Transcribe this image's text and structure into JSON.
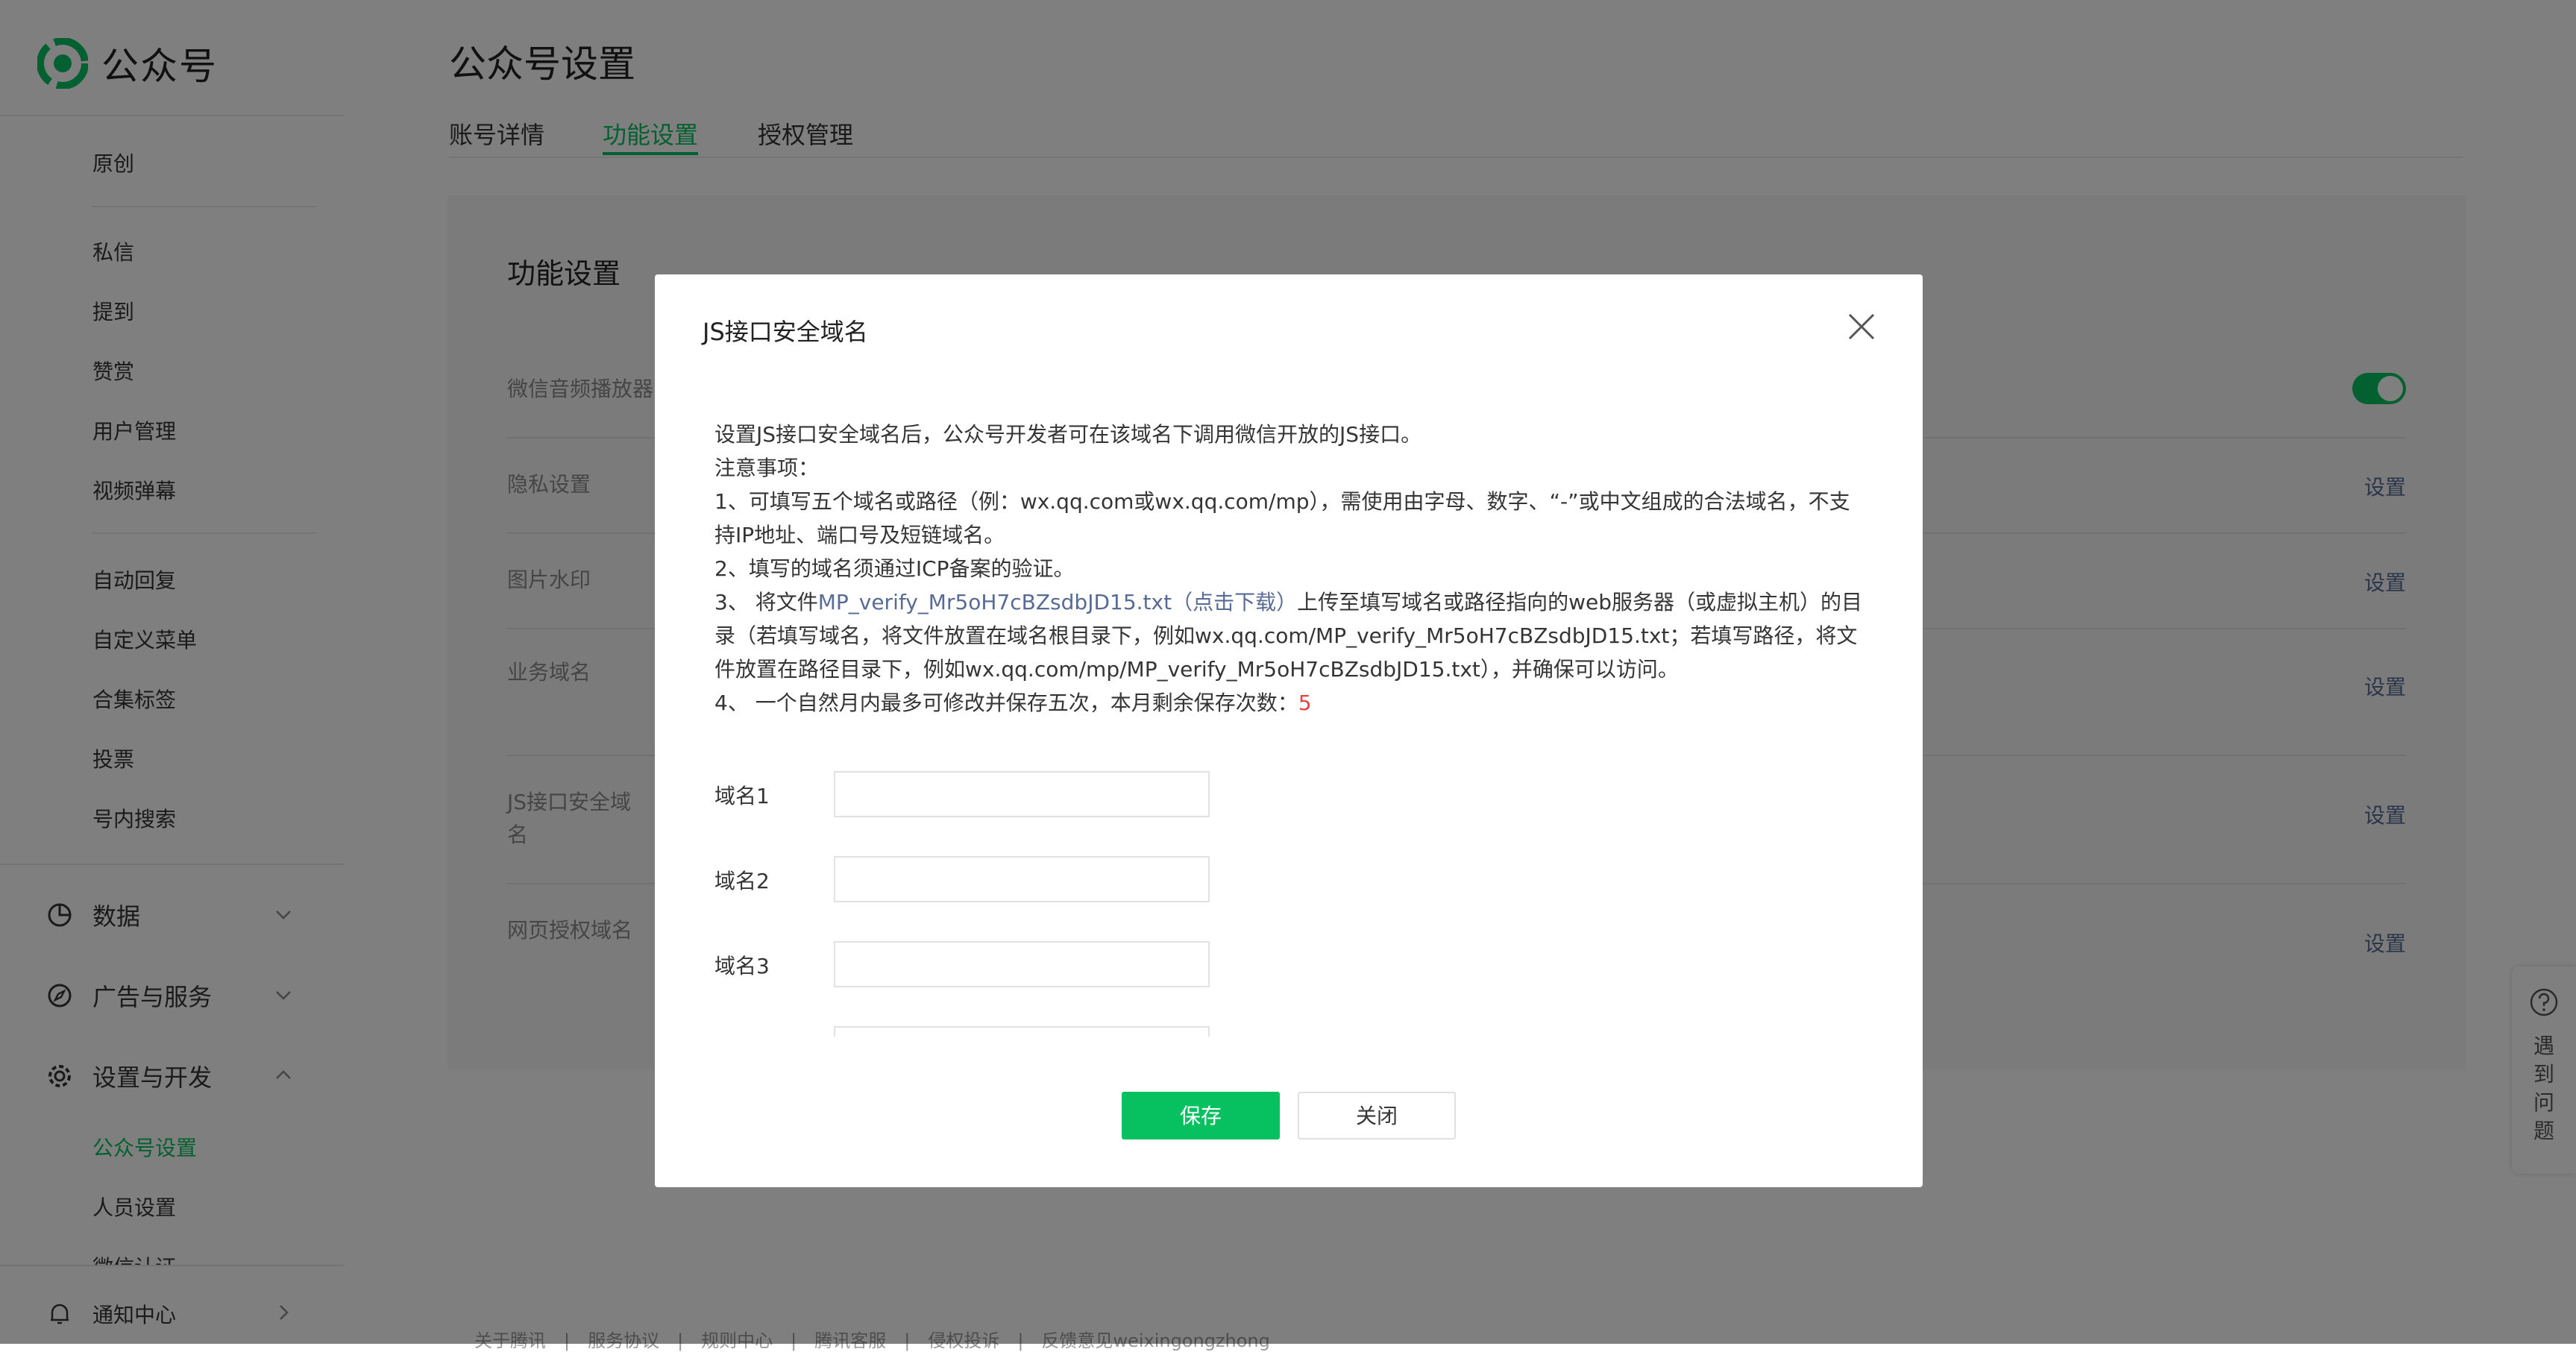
{
  "app": {
    "logo_text": "公众号"
  },
  "sidebar": {
    "items_a": [
      "原创"
    ],
    "items_b": [
      "私信",
      "提到",
      "赞赏",
      "用户管理",
      "视频弹幕"
    ],
    "items_c": [
      "自动回复",
      "自定义菜单",
      "合集标签",
      "投票",
      "号内搜索"
    ],
    "groups": {
      "data": "数据",
      "ads": "广告与服务",
      "settings": "设置与开发"
    },
    "settings_children": [
      "公众号设置",
      "人员设置",
      "微信认证"
    ],
    "notify": "通知中心"
  },
  "page": {
    "title": "公众号设置",
    "tabs": [
      "账号详情",
      "功能设置",
      "授权管理"
    ],
    "panel_title": "功能设置",
    "rows": [
      {
        "label": "微信音频播放器"
      },
      {
        "label": "隐私设置",
        "action": "设置"
      },
      {
        "label": "图片水印",
        "action": "设置"
      },
      {
        "label": "业务域名",
        "action": "设置"
      },
      {
        "label": "JS接口安全域名",
        "action": "设置"
      },
      {
        "label": "网页授权域名",
        "action": "设置"
      }
    ],
    "footer": "关于腾讯　|　服务协议　|　规则中心　|　腾讯客服　|　侵权投诉　|　反馈意见weixingongzhong"
  },
  "help": {
    "text": [
      "遇",
      "到",
      "问",
      "题"
    ],
    "icon": "question-circle-icon"
  },
  "dialog": {
    "title": "JS接口安全域名",
    "intro": "设置JS接口安全域名后，公众号开发者可在该域名下调用微信开放的JS接口。",
    "notice_title": "注意事项：",
    "note1": "1、可填写五个域名或路径（例：wx.qq.com或wx.qq.com/mp），需使用由字母、数字、“-”或中文组成的合法域名，不支持IP地址、端口号及短链域名。",
    "note2": "2、填写的域名须通过ICP备案的验证。",
    "note3_prefix": "3、 将文件",
    "note3_link": "MP_verify_Mr5oH7cBZsdbJD15.txt（点击下载）",
    "note3_suffix": "上传至填写域名或路径指向的web服务器（或虚拟主机）的目录（若填写域名，将文件放置在域名根目录下，例如wx.qq.com/MP_verify_Mr5oH7cBZsdbJD15.txt；若填写路径，将文件放置在路径目录下，例如wx.qq.com/mp/MP_verify_Mr5oH7cBZsdbJD15.txt），并确保可以访问。",
    "note4_prefix": "4、 一个自然月内最多可修改并保存五次，本月剩余保存次数：",
    "note4_count": "5",
    "fields": [
      {
        "label": "域名1",
        "value": ""
      },
      {
        "label": "域名2",
        "value": ""
      },
      {
        "label": "域名3",
        "value": ""
      }
    ],
    "save_label": "保存",
    "close_label": "关闭"
  },
  "colors": {
    "accent": "#07c160",
    "link": "#576b95",
    "danger": "#e64340",
    "overlay": "rgba(0,0,0,0.5)"
  }
}
